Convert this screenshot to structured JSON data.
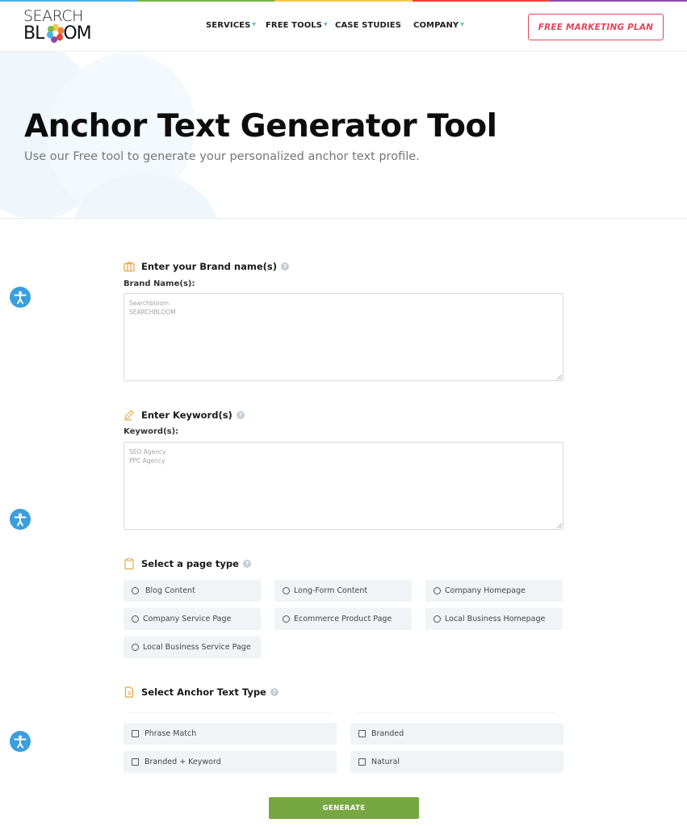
{
  "colors": {
    "rainbow": [
      "#4ab0e4",
      "#7ab648",
      "#f2c94c",
      "#e8443a",
      "#8c4aa8"
    ],
    "accent_red": "#e0475a",
    "generate_green": "#77a740",
    "icon_orange": "#e8a33d",
    "accessibility_blue": "#3a9fdc"
  },
  "header": {
    "logo": {
      "line1": "SEARCH",
      "line2_prefix": "BL",
      "line2_suffix": "OM"
    },
    "nav": [
      {
        "label": "SERVICES",
        "has_dropdown": true
      },
      {
        "label": "FREE TOOLS",
        "has_dropdown": true
      },
      {
        "label": "CASE STUDIES",
        "has_dropdown": false
      },
      {
        "label": "COMPANY",
        "has_dropdown": true
      }
    ],
    "caret": "▼",
    "cta_label": "FREE MARKETING PLAN"
  },
  "hero": {
    "title": "Anchor Text Generator Tool",
    "subtitle": "Use our Free tool to generate your personalized anchor text profile."
  },
  "form": {
    "brand": {
      "icon": "briefcase-icon",
      "title": "Enter your Brand name(s)",
      "help": "?",
      "label": "Brand Name(s):",
      "placeholder_lines": [
        "Searchbloom",
        "SEARCHBLOOM"
      ]
    },
    "keywords": {
      "icon": "pencil-icon",
      "title": "Enter Keyword(s)",
      "help": "?",
      "label": "Keyword(s):",
      "placeholder_lines": [
        "SEO Agency",
        "PPC Agency"
      ]
    },
    "page_type": {
      "icon": "clipboard-icon",
      "title": "Select a page type",
      "help": "?",
      "options": [
        "Blog Content",
        "Long-Form Content",
        "Company Homepage",
        "Company Service Page",
        "Ecommerce Product Page",
        "Local Business Homepage",
        "Local Business Service Page"
      ]
    },
    "anchor_type": {
      "icon": "document-icon",
      "title": "Select Anchor Text Type",
      "help": "?",
      "options": [
        "Phrase Match",
        "Branded",
        "Branded + Keyword",
        "Natural"
      ]
    },
    "generate_label": "GENERATE"
  }
}
